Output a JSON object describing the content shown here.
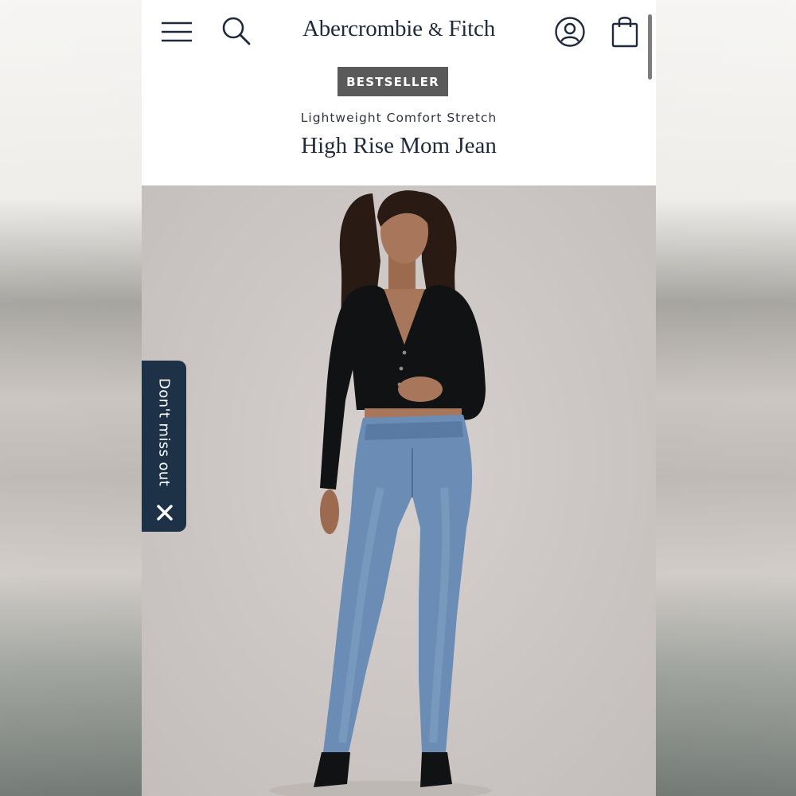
{
  "header": {
    "brand": "Abercrombie",
    "brand_amp": "&",
    "brand_tail": "Fitch",
    "icons": {
      "menu": "hamburger-menu-icon",
      "search": "search-icon",
      "account": "account-icon",
      "bag": "shopping-bag-icon"
    }
  },
  "product": {
    "badge": "BESTSELLER",
    "subtitle": "Lightweight Comfort Stretch",
    "title": "High Rise Mom Jean"
  },
  "promo": {
    "label": "Don't miss out",
    "close_icon": "close-icon"
  },
  "colors": {
    "brand_navy": "#1f2a3c",
    "badge_gray": "#5a5a5a",
    "promo_navy": "#1d3147"
  }
}
